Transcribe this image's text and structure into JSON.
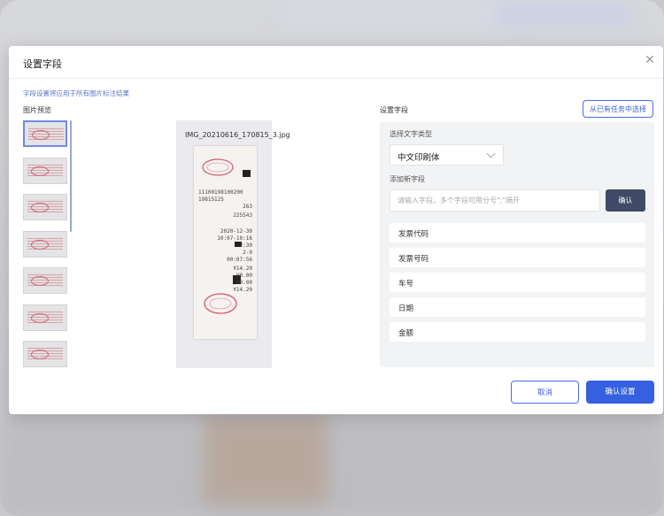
{
  "dialog": {
    "title": "设置字段",
    "hint": "字段设置将应用于所有图片标注结果",
    "preview_label": "图片预览",
    "preview_filename": "IMG_20210616_170815_3.jpg",
    "thumbnails": [
      "thumb-1",
      "thumb-2",
      "thumb-3",
      "thumb-4",
      "thumb-5",
      "thumb-6",
      "thumb-7"
    ],
    "receipt_text": {
      "lines": [
        "11100198100200",
        "19815125",
        "263",
        "225543",
        "2020-12-30",
        "10:07-10:16",
        "2:30",
        "2-9",
        "00:07:56",
        "¥14.20",
        "¥0.00",
        "¥0.00",
        "¥14.20"
      ]
    }
  },
  "fields_panel": {
    "label": "设置字段",
    "pick_from_task_button": "从已有任务中选择",
    "select_type_label": "选择文字类型",
    "select_type_value": "中文印刷体",
    "add_field_label": "添加新字段",
    "add_field_placeholder": "请输入字段，多个字段可用分号\";\"隔开",
    "add_confirm": "确认",
    "fields": [
      "发票代码",
      "发票号码",
      "车号",
      "日期",
      "金额"
    ]
  },
  "footer": {
    "cancel": "取消",
    "confirm": "确认设置"
  },
  "colors": {
    "primary": "#3560e0",
    "dark_button": "#3e4a66",
    "panel_bg": "#f2f3f5"
  }
}
